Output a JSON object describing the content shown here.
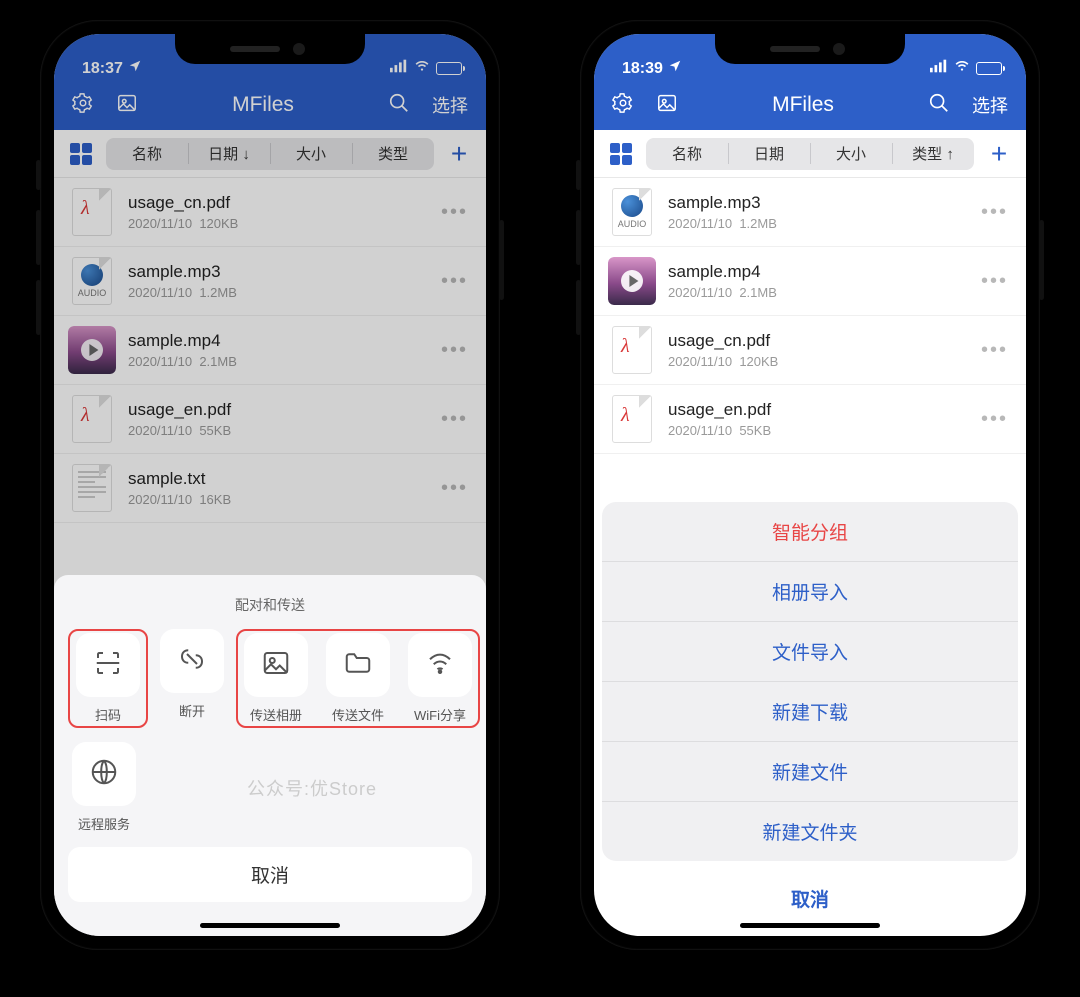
{
  "phone1": {
    "status": {
      "time": "18:37",
      "location_arrow": true
    },
    "nav": {
      "title": "MFiles",
      "select": "选择"
    },
    "sort": {
      "name": "名称",
      "date": "日期 ↓",
      "size": "大小",
      "type": "类型"
    },
    "files": [
      {
        "name": "usage_cn.pdf",
        "date": "2020/11/10",
        "size": "120KB",
        "kind": "pdf"
      },
      {
        "name": "sample.mp3",
        "date": "2020/11/10",
        "size": "1.2MB",
        "kind": "audio"
      },
      {
        "name": "sample.mp4",
        "date": "2020/11/10",
        "size": "2.1MB",
        "kind": "video"
      },
      {
        "name": "usage_en.pdf",
        "date": "2020/11/10",
        "size": "55KB",
        "kind": "pdf"
      },
      {
        "name": "sample.txt",
        "date": "2020/11/10",
        "size": "16KB",
        "kind": "text"
      }
    ],
    "sheet": {
      "title": "配对和传送",
      "row1": [
        {
          "label": "扫码",
          "icon": "scan"
        },
        {
          "label": "断开",
          "icon": "unlink"
        },
        {
          "label": "传送相册",
          "icon": "image"
        },
        {
          "label": "传送文件",
          "icon": "folder"
        },
        {
          "label": "WiFi分享",
          "icon": "wifi"
        }
      ],
      "row2": {
        "label": "远程服务",
        "icon": "globe"
      },
      "watermark": "公众号:优Store",
      "cancel": "取消"
    }
  },
  "phone2": {
    "status": {
      "time": "18:39",
      "location_arrow": true
    },
    "nav": {
      "title": "MFiles",
      "select": "选择"
    },
    "sort": {
      "name": "名称",
      "date": "日期",
      "size": "大小",
      "type": "类型 ↑"
    },
    "files": [
      {
        "name": "sample.mp3",
        "date": "2020/11/10",
        "size": "1.2MB",
        "kind": "audio"
      },
      {
        "name": "sample.mp4",
        "date": "2020/11/10",
        "size": "2.1MB",
        "kind": "video"
      },
      {
        "name": "usage_cn.pdf",
        "date": "2020/11/10",
        "size": "120KB",
        "kind": "pdf"
      },
      {
        "name": "usage_en.pdf",
        "date": "2020/11/10",
        "size": "55KB",
        "kind": "pdf"
      }
    ],
    "actions": {
      "items": [
        {
          "label": "智能分组",
          "destructive": true
        },
        {
          "label": "相册导入",
          "destructive": false
        },
        {
          "label": "文件导入",
          "destructive": false
        },
        {
          "label": "新建下载",
          "destructive": false
        },
        {
          "label": "新建文件",
          "destructive": false
        },
        {
          "label": "新建文件夹",
          "destructive": false
        }
      ],
      "cancel": "取消"
    }
  }
}
